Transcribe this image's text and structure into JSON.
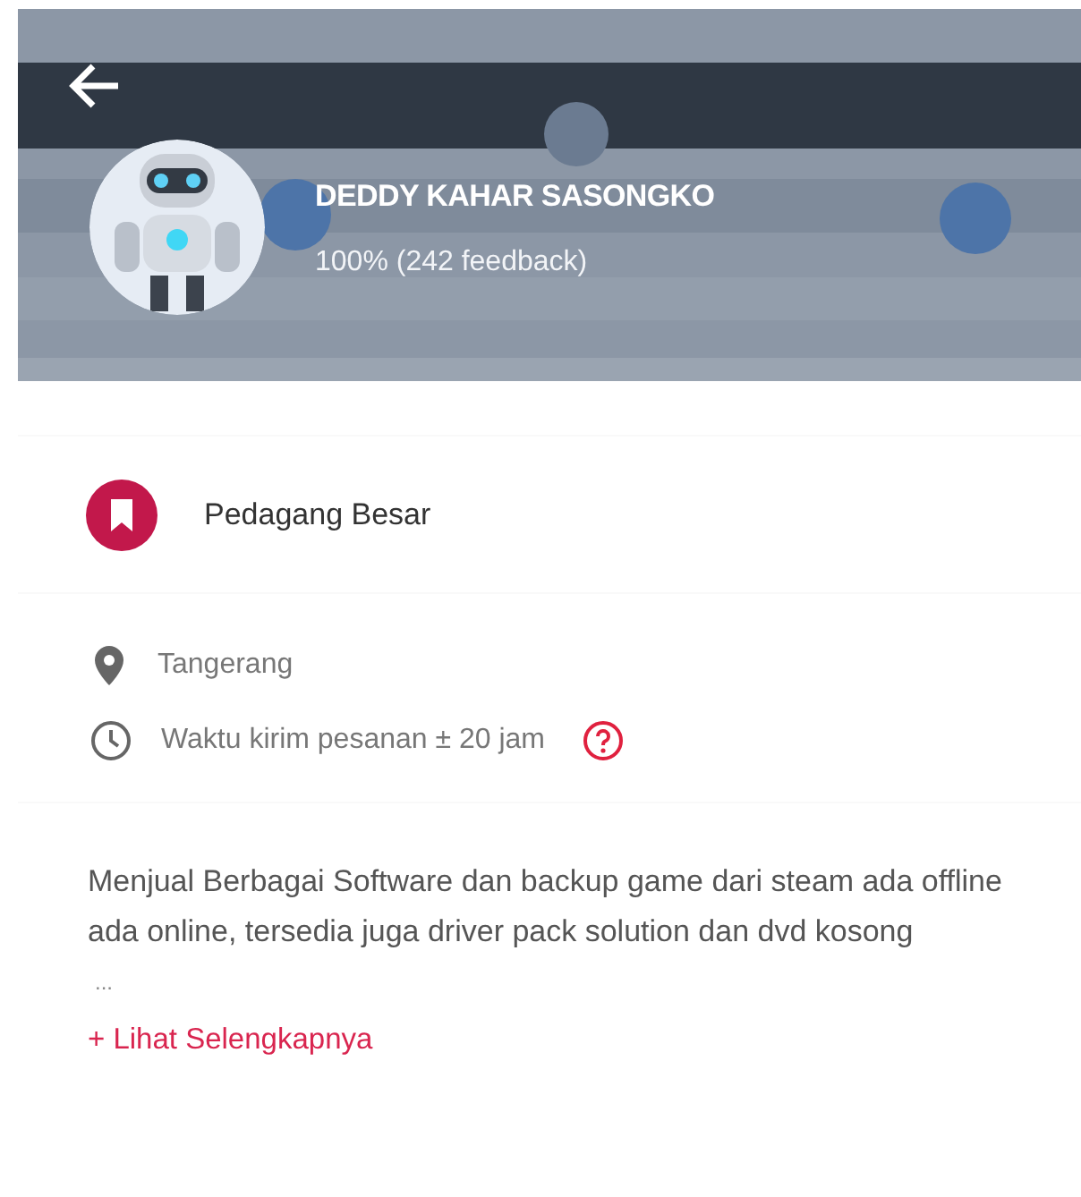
{
  "header": {
    "kind": "picture",
    "seller_name": "DEDDY KAHAR SASONGKO",
    "rating": "100% (242 feedback)"
  },
  "badge": {
    "label": "Pedagang Besar"
  },
  "info": [
    {
      "kind": "location",
      "text": "Tangerang"
    },
    {
      "kind": "time",
      "text": "Waktu kirim pesanan ± 20 jam",
      "help": true
    }
  ],
  "description": {
    "text": "Menjual Berbagai Software dan backup game dari steam ada offline ada online, tersedia juga driver pack solution dan dvd kosong",
    "ellipsis": "...",
    "more_link": "+ Lihat Selengkapnya"
  }
}
